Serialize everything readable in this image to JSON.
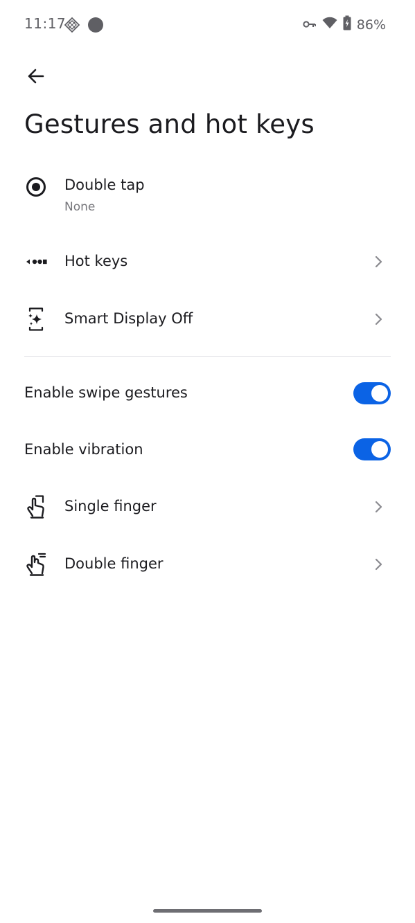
{
  "status_bar": {
    "time": "11:17",
    "battery": "86%",
    "icons": [
      "pinwheel-icon",
      "circle-notification-icon",
      "vpn-key-icon",
      "wifi-icon",
      "battery-charging-icon"
    ]
  },
  "header": {
    "back_icon": "arrow-left-icon",
    "title": "Gestures and hot keys"
  },
  "items": [
    {
      "label": "Double tap",
      "sub": "None",
      "icon": "radio-dot-icon"
    },
    {
      "label": "Hot keys",
      "icon": "dots-arrow-icon"
    },
    {
      "label": "Smart Display Off",
      "icon": "display-sparkle-icon"
    }
  ],
  "toggles": [
    {
      "label": "Enable swipe gestures",
      "state": "on"
    },
    {
      "label": "Enable vibration",
      "state": "on"
    }
  ],
  "gestures": [
    {
      "label": "Single finger",
      "icon": "single-finger-icon"
    },
    {
      "label": "Double finger",
      "icon": "double-finger-icon"
    }
  ],
  "colors": {
    "accent": "#0b63e5",
    "text": "#1b1b1f",
    "subtext": "#76767b"
  }
}
